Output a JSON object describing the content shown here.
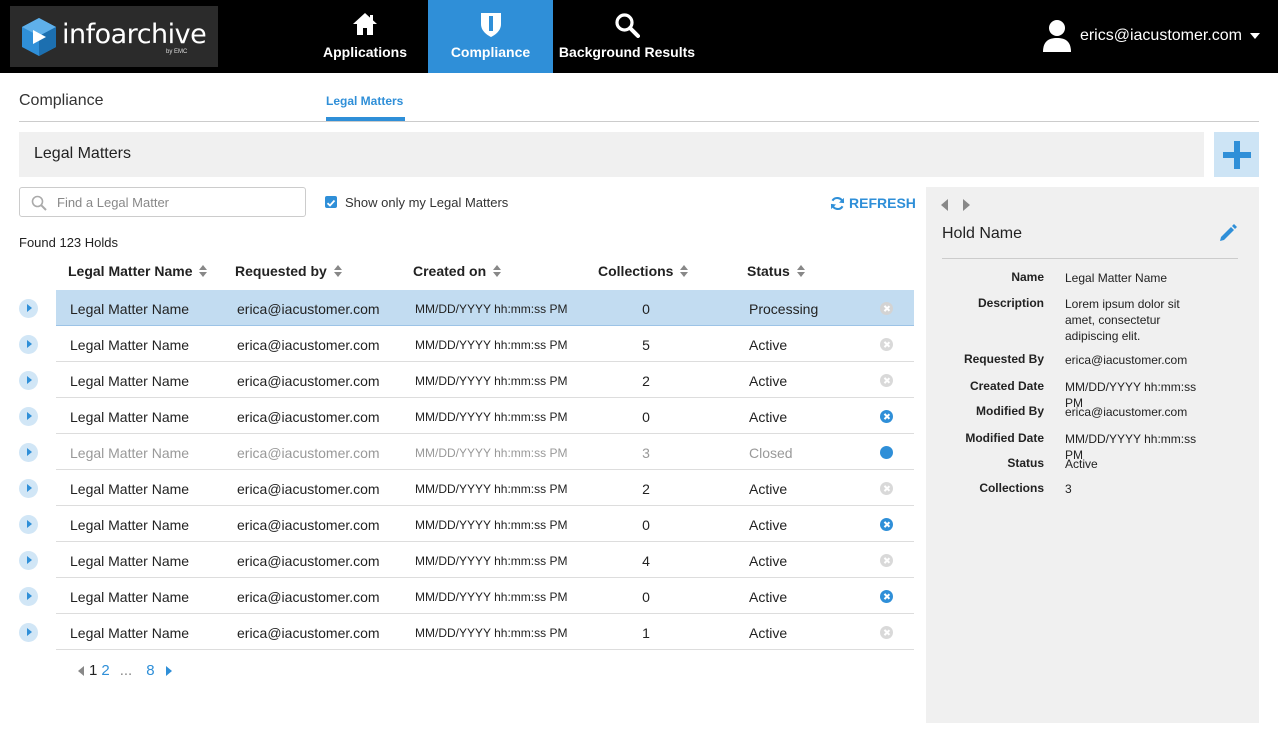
{
  "brand": {
    "name": "infoarchive",
    "by": "by EMC"
  },
  "nav": {
    "items": [
      {
        "label": "Applications",
        "icon": "home-icon"
      },
      {
        "label": "Compliance",
        "icon": "shield-icon",
        "active": true
      },
      {
        "label": "Background Results",
        "icon": "search-icon"
      }
    ],
    "user": "erics@iacustomer.com"
  },
  "subheader": {
    "section": "Compliance",
    "tab": "Legal Matters"
  },
  "titlebar": {
    "title": "Legal Matters"
  },
  "search": {
    "placeholder": "Find a Legal Matter",
    "value": ""
  },
  "filter": {
    "label": "Show only my Legal Matters",
    "checked": true
  },
  "refresh_label": "REFRESH",
  "found": "Found 123 Holds",
  "table": {
    "headers": [
      "Legal Matter Name",
      "Requested by",
      "Created on",
      "Collections",
      "Status"
    ],
    "rows": [
      {
        "name": "Legal Matter Name",
        "requested_by": "erica@iacustomer.com",
        "created_on": "MM/DD/YYYY hh:mm:ss PM",
        "collections": "0",
        "status": "Processing",
        "action": "x-grey",
        "selected": true
      },
      {
        "name": "Legal Matter Name",
        "requested_by": "erica@iacustomer.com",
        "created_on": "MM/DD/YYYY hh:mm:ss PM",
        "collections": "5",
        "status": "Active",
        "action": "x-grey"
      },
      {
        "name": "Legal Matter Name",
        "requested_by": "erica@iacustomer.com",
        "created_on": "MM/DD/YYYY hh:mm:ss PM",
        "collections": "2",
        "status": "Active",
        "action": "x-grey"
      },
      {
        "name": "Legal Matter Name",
        "requested_by": "erica@iacustomer.com",
        "created_on": "MM/DD/YYYY hh:mm:ss PM",
        "collections": "0",
        "status": "Active",
        "action": "x-blue"
      },
      {
        "name": "Legal Matter Name",
        "requested_by": "erica@iacustomer.com",
        "created_on": "MM/DD/YYYY hh:mm:ss PM",
        "collections": "3",
        "status": "Closed",
        "action": "dot",
        "closed": true
      },
      {
        "name": "Legal Matter Name",
        "requested_by": "erica@iacustomer.com",
        "created_on": "MM/DD/YYYY hh:mm:ss PM",
        "collections": "2",
        "status": "Active",
        "action": "x-grey"
      },
      {
        "name": "Legal Matter Name",
        "requested_by": "erica@iacustomer.com",
        "created_on": "MM/DD/YYYY hh:mm:ss PM",
        "collections": "0",
        "status": "Active",
        "action": "x-blue"
      },
      {
        "name": "Legal Matter Name",
        "requested_by": "erica@iacustomer.com",
        "created_on": "MM/DD/YYYY hh:mm:ss PM",
        "collections": "4",
        "status": "Active",
        "action": "x-grey"
      },
      {
        "name": "Legal Matter Name",
        "requested_by": "erica@iacustomer.com",
        "created_on": "MM/DD/YYYY hh:mm:ss PM",
        "collections": "0",
        "status": "Active",
        "action": "x-blue"
      },
      {
        "name": "Legal Matter Name",
        "requested_by": "erica@iacustomer.com",
        "created_on": "MM/DD/YYYY hh:mm:ss PM",
        "collections": "1",
        "status": "Active",
        "action": "x-grey"
      }
    ]
  },
  "pager": {
    "current": "1",
    "next": "2",
    "ellipsis": "...",
    "last": "8"
  },
  "panel": {
    "title": "Hold Name",
    "fields": [
      {
        "label": "Name",
        "value": "Legal Matter Name"
      },
      {
        "label": "Description",
        "value": "Lorem ipsum dolor sit amet, consectetur adipiscing elit."
      },
      {
        "label": "Requested By",
        "value": "erica@iacustomer.com"
      },
      {
        "label": "Created Date",
        "value": "MM/DD/YYYY hh:mm:ss PM"
      },
      {
        "label": "Modified By",
        "value": "erica@iacustomer.com"
      },
      {
        "label": "Modified Date",
        "value": "MM/DD/YYYY hh:mm:ss PM"
      },
      {
        "label": "Status",
        "value": "Active"
      },
      {
        "label": "Collections",
        "value": "3"
      }
    ]
  },
  "colors": {
    "accent": "#2f8fd8",
    "selected_row": "#c2dcf1",
    "topbar": "#000000",
    "panel": "#f0f0f0"
  }
}
